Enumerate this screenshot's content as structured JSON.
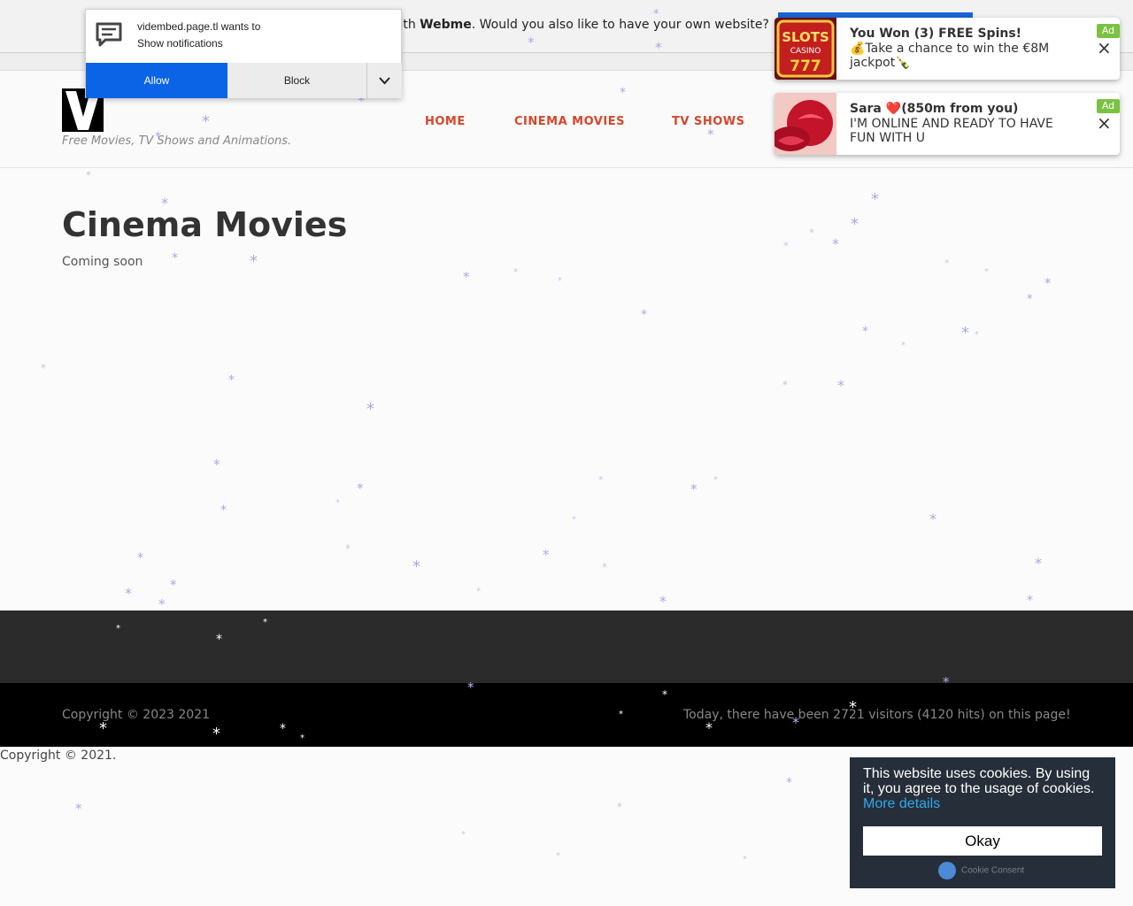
{
  "promo": {
    "text_prefix": "with ",
    "brand": "Webme",
    "text_suffix": ". Would you also like to have your own website?"
  },
  "header": {
    "tagline": "Free Movies, TV Shows and Animations.",
    "nav": [
      "HOME",
      "CINEMA MOVIES",
      "TV SHOWS"
    ]
  },
  "main": {
    "title": "Cinema Movies",
    "text": "Coming soon"
  },
  "footer": {
    "copyright": "Copyright © 2023 2021",
    "visitors": "Today, there have been 2721 visitors (4120 hits) on this page!",
    "bottom_copyright": "Copyright © 2021."
  },
  "notification": {
    "line1": "videmb​ed.page.tl wants to",
    "line2": "Show notifications",
    "allow": "Allow",
    "block": "Block"
  },
  "ads": [
    {
      "title": "You Won (3) FREE Spins!",
      "body": "💰Take a chance to win the €8M jackpot🍾",
      "badge": "Ad"
    },
    {
      "title": "Sara ❤️(850m from you)",
      "body": "I'M ONLINE AND READY TO HAVE FUN WITH U",
      "badge": "Ad"
    }
  ],
  "cookie": {
    "text": "This website uses cookies. By using it, you agree to the usage of cookies.",
    "link": "More details",
    "button": "Okay",
    "brand": "Cookie Consent"
  },
  "colors": {
    "nav": "#d7462c",
    "allow_button": "#0b63e5",
    "cookie_bg": "#252e39",
    "cookie_link": "#31a8f0",
    "ad_badge": "#7cc242"
  }
}
